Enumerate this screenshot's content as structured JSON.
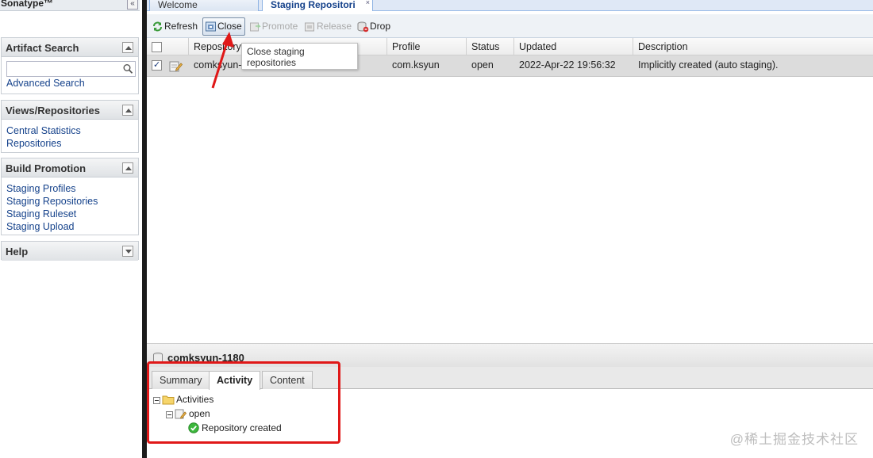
{
  "brand": {
    "name": "Sonatype™",
    "collapse_glyph": "«"
  },
  "sidebar": {
    "artifact_search": {
      "title": "Artifact Search",
      "placeholder": "",
      "advanced_link": "Advanced Search"
    },
    "views": {
      "title": "Views/Repositories",
      "items": [
        "Central Statistics",
        "Repositories"
      ]
    },
    "build_promotion": {
      "title": "Build Promotion",
      "items": [
        "Staging Profiles",
        "Staging Repositories",
        "Staging Ruleset",
        "Staging Upload"
      ]
    },
    "help": {
      "title": "Help"
    }
  },
  "tabs": {
    "welcome": "Welcome",
    "staging": "Staging Repositori",
    "close_glyph": "×"
  },
  "toolbar": {
    "refresh": "Refresh",
    "close": "Close",
    "promote": "Promote",
    "release": "Release",
    "drop": "Drop"
  },
  "tooltip": {
    "line1": "Close staging",
    "line2": "repositories"
  },
  "grid": {
    "columns": {
      "repository": "Repository",
      "profile": "Profile",
      "status": "Status",
      "updated": "Updated",
      "description": "Description"
    },
    "row": {
      "repository": "comksyun-",
      "profile": "com.ksyun",
      "status": "open",
      "updated": "2022-Apr-22 19:56:32",
      "description": "Implicitly created (auto staging)."
    }
  },
  "detail": {
    "title": "comksyun-1180",
    "tabs": [
      "Summary",
      "Activity",
      "Content"
    ],
    "tree": {
      "root": "Activities",
      "child": "open",
      "leaf": "Repository created"
    }
  },
  "watermark": "@稀土掘金技术社区",
  "colors": {
    "highlight": "#e01818",
    "link": "#15428b"
  }
}
